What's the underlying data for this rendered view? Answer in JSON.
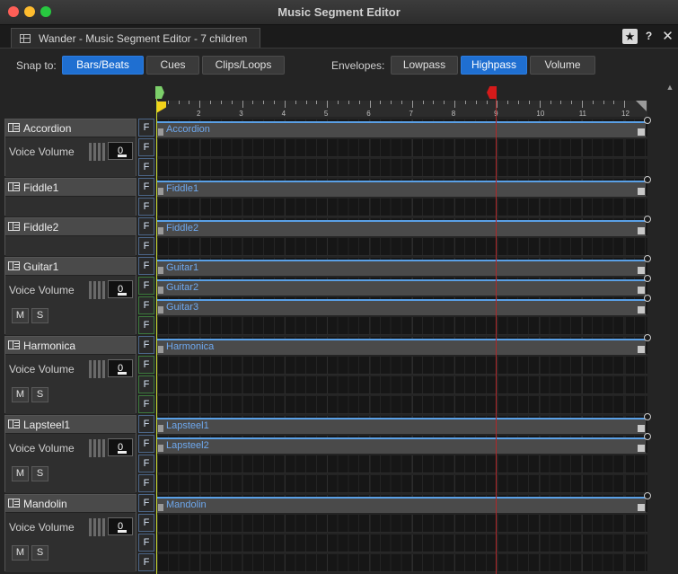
{
  "window": {
    "title": "Music Segment Editor",
    "tab_title": "Wander - Music Segment Editor - 7 children"
  },
  "toolbar": {
    "snap_label": "Snap to:",
    "snap_options": [
      {
        "label": "Bars/Beats",
        "active": true
      },
      {
        "label": "Cues",
        "active": false
      },
      {
        "label": "Clips/Loops",
        "active": false
      }
    ],
    "envelopes_label": "Envelopes:",
    "envelope_options": [
      {
        "label": "Lowpass",
        "active": false
      },
      {
        "label": "Highpass",
        "active": true
      },
      {
        "label": "Volume",
        "active": false
      }
    ]
  },
  "ruler": {
    "bar_labels": [
      "2",
      "3",
      "4",
      "5",
      "6",
      "7",
      "8",
      "9",
      "10",
      "11",
      "12"
    ]
  },
  "tracks": [
    {
      "name": "Accordion",
      "voice_volume_label": "Voice Volume",
      "voice_volume": "0",
      "has_ms": false,
      "lanes": 3,
      "clips": [
        "Accordion"
      ]
    },
    {
      "name": "Fiddle1",
      "voice_volume_label": "",
      "voice_volume": "",
      "has_ms": false,
      "lanes": 2,
      "clips": [
        "Fiddle1"
      ]
    },
    {
      "name": "Fiddle2",
      "voice_volume_label": "",
      "voice_volume": "",
      "has_ms": false,
      "lanes": 2,
      "clips": [
        "Fiddle2"
      ]
    },
    {
      "name": "Guitar1",
      "voice_volume_label": "Voice Volume",
      "voice_volume": "0",
      "has_ms": true,
      "lanes": 4,
      "clips": [
        "Guitar1",
        "Guitar2",
        "Guitar3"
      ]
    },
    {
      "name": "Harmonica",
      "voice_volume_label": "Voice Volume",
      "voice_volume": "0",
      "has_ms": true,
      "lanes": 4,
      "clips": [
        "Harmonica"
      ]
    },
    {
      "name": "Lapsteel1",
      "voice_volume_label": "Voice Volume",
      "voice_volume": "0",
      "has_ms": true,
      "lanes": 4,
      "clips": [
        "Lapsteel1",
        "Lapsteel2"
      ]
    },
    {
      "name": "Mandolin",
      "voice_volume_label": "Voice Volume",
      "voice_volume": "0",
      "has_ms": true,
      "lanes": 4,
      "clips": [
        "Mandolin"
      ]
    }
  ],
  "buttons": {
    "mute": "M",
    "solo": "S",
    "f": "F"
  },
  "icons": {
    "pin": "pin-icon",
    "help": "help-icon",
    "close": "close-icon"
  }
}
